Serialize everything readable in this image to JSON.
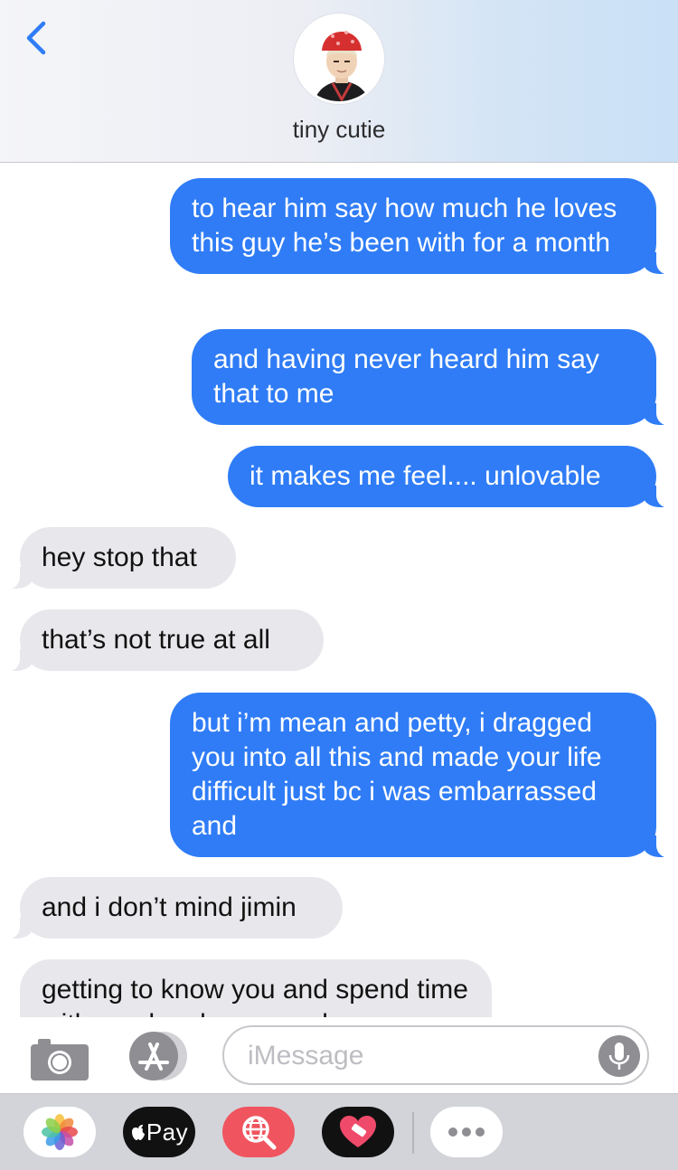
{
  "header": {
    "contact_name": "tiny cutie",
    "back_icon": "chevron-left-icon",
    "avatar_icon": "contact-avatar"
  },
  "messages": [
    {
      "sender": "me",
      "text": "to hear him say how much he loves this guy he’s been with for a month"
    },
    {
      "sender": "me",
      "text": "and having never heard him say that to me"
    },
    {
      "sender": "me",
      "text": "it makes me feel.... unlovable"
    },
    {
      "sender": "them",
      "text": "hey stop that"
    },
    {
      "sender": "them",
      "text": "that’s not true at all"
    },
    {
      "sender": "me",
      "text": "but i’m mean and petty, i dragged you into all this and made your life difficult just bc i was embarrassed and"
    },
    {
      "sender": "them",
      "text": "and i don’t mind jimin"
    },
    {
      "sender": "them",
      "text": "getting to know you and spend time with you has been good"
    }
  ],
  "input_bar": {
    "placeholder": "iMessage",
    "camera_icon": "camera-icon",
    "appstore_icon": "app-store-icon",
    "mic_icon": "microphone-icon"
  },
  "app_drawer": {
    "apple_pay_label": "Pay",
    "apps": [
      "photos-icon",
      "apple-pay-icon",
      "web-search-icon",
      "heart-app-icon",
      "more-apps-icon"
    ]
  },
  "colors": {
    "sent_bubble": "#2f7cf6",
    "received_bubble": "#e8e8ec",
    "accent": "#2f7cf6"
  }
}
